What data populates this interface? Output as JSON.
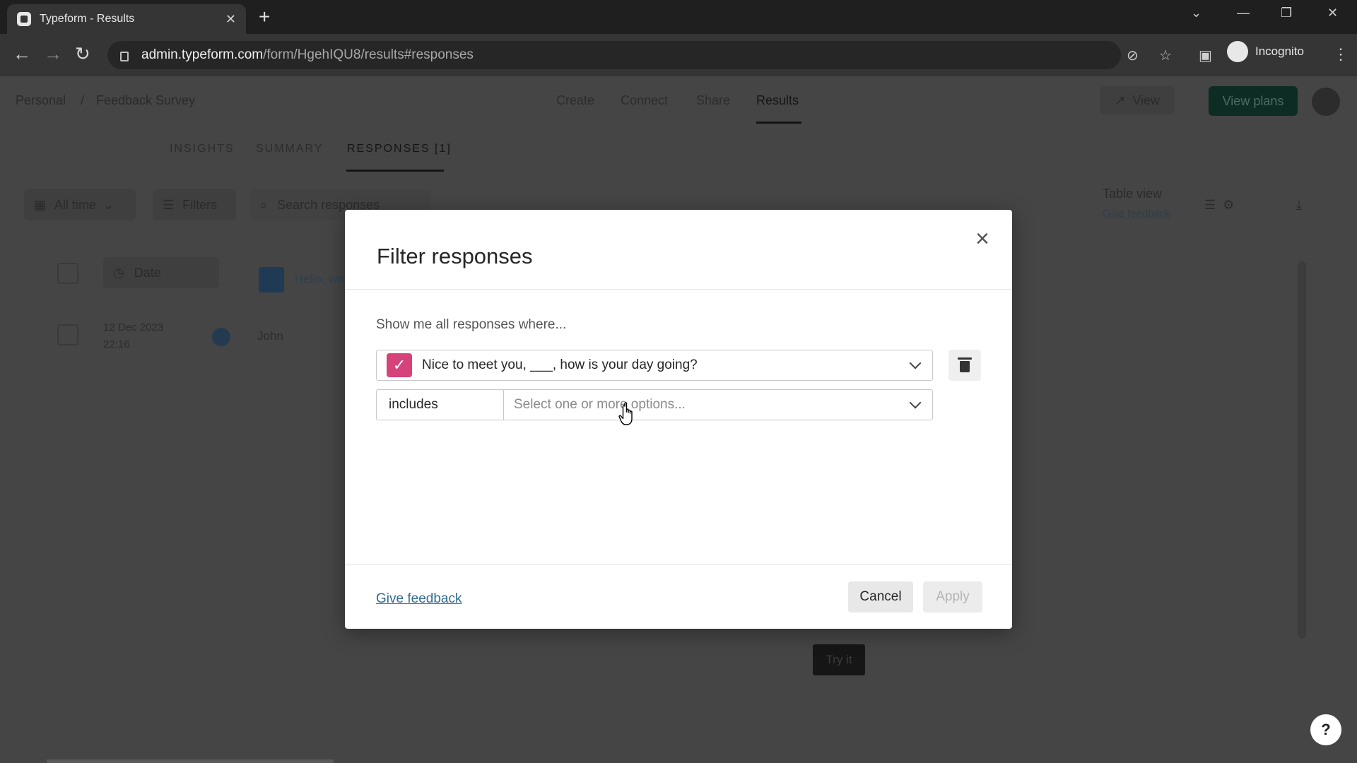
{
  "browser": {
    "tab_title": "Typeform - Results",
    "url_domain": "admin.typeform.com",
    "url_path": "/form/HgehIQU8/results#responses",
    "profile_label": "Incognito"
  },
  "header": {
    "breadcrumb": [
      "Personal",
      "/",
      "Feedback Survey"
    ],
    "nav": [
      "Create",
      "Connect",
      "Share",
      "Results"
    ],
    "view_label": "View",
    "plans_label": "View plans"
  },
  "results_tabs": [
    "INSIGHTS",
    "SUMMARY",
    "RESPONSES [1]"
  ],
  "filterbar": {
    "time_label": "All time",
    "filters_label": "Filters",
    "search_placeholder": "Search responses",
    "table_view_label": "Table view",
    "give_feedback_label": "Give feedback"
  },
  "table": {
    "date_header": "Date",
    "question_header": "Hello, wh",
    "row_date": "12 Dec 2023",
    "row_time": "22:16",
    "row_name": "John"
  },
  "try_it_label": "Try it",
  "help_label": "?",
  "modal": {
    "title": "Filter responses",
    "prompt": "Show me all responses where...",
    "question": "Nice to meet you, ___, how is your day going?",
    "operator": "includes",
    "options_placeholder": "Select one or more options...",
    "feedback_link": "Give feedback",
    "cancel_label": "Cancel",
    "apply_label": "Apply",
    "accent_color": "#d6437a"
  }
}
